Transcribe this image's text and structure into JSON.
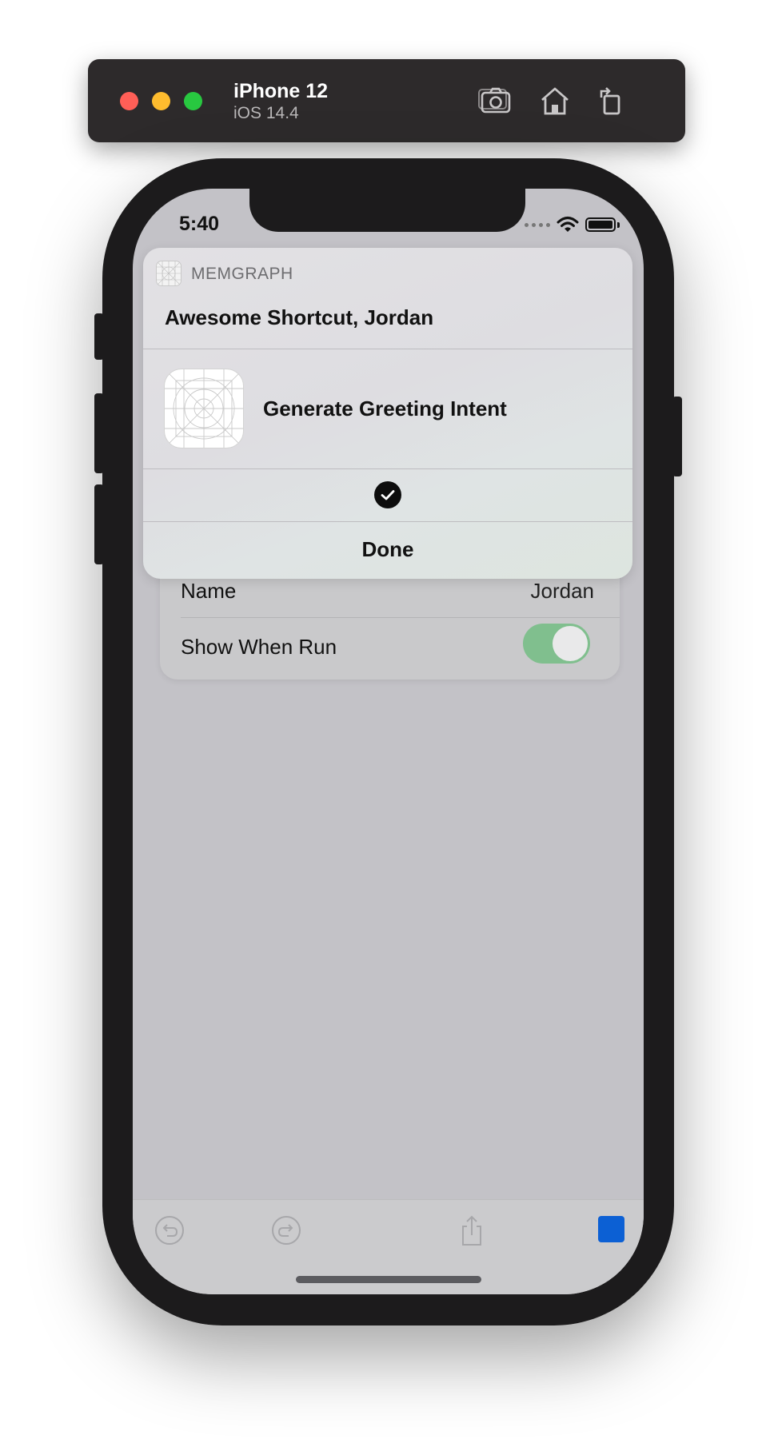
{
  "simulator": {
    "device_name": "iPhone 12",
    "os_version": "iOS 14.4",
    "buttons": [
      "screenshot-icon",
      "home-icon",
      "rotate-icon"
    ]
  },
  "status_bar": {
    "time": "5:40"
  },
  "notification": {
    "app_name": "MEMGRAPH",
    "title": "Awesome Shortcut, Jordan",
    "intent_label": "Generate Greeting Intent",
    "done_label": "Done"
  },
  "settings": {
    "rows": [
      {
        "label": "Name",
        "value": "Jordan"
      },
      {
        "label": "Show When Run",
        "toggle_on": true
      }
    ]
  },
  "toolbar": {
    "items": [
      "undo-icon",
      "redo-icon",
      "share-icon",
      "stop-button"
    ]
  },
  "colors": {
    "toggle_on": "#80bf8e",
    "stop_button": "#0c60d4",
    "screen_dim": "#c3c2c7"
  }
}
